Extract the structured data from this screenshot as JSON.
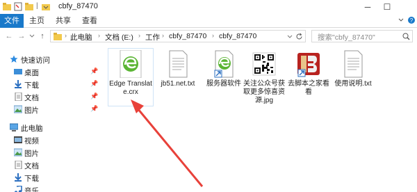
{
  "window": {
    "title": "cbfy_87470",
    "minimize_label": "─",
    "maximize_label": "☐"
  },
  "ribbon": {
    "tabs": [
      {
        "label": "文件",
        "active": true
      },
      {
        "label": "主页",
        "active": false
      },
      {
        "label": "共享",
        "active": false
      },
      {
        "label": "查看",
        "active": false
      }
    ],
    "expand_icon": "chevron-down-icon",
    "help_icon": "help-icon"
  },
  "address": {
    "back_label": "←",
    "forward_label": "→",
    "up_label": "↑",
    "crumbs": [
      "此电脑",
      "文档 (E:)",
      "工作",
      "cbfy_87470",
      "cbfy_87470"
    ],
    "separator": "›"
  },
  "search": {
    "placeholder": "搜索\"cbfy_87470\"",
    "icon": "search-icon"
  },
  "nav": {
    "quick_access": "快速访问",
    "quick_items": [
      "桌面",
      "下载",
      "文档",
      "图片"
    ],
    "this_pc": "此电脑",
    "pc_items": [
      "视频",
      "图片",
      "文档",
      "下载",
      "音乐"
    ]
  },
  "files": [
    {
      "name": "Edge Translate.crx",
      "icon": "edge-icon",
      "selected": true
    },
    {
      "name": "jb51.net.txt",
      "icon": "text-file-icon",
      "selected": false
    },
    {
      "name": "服务器软件",
      "icon": "edge-icon",
      "selected": false
    },
    {
      "name": "关注公众号获取更多惊喜资源.jpg",
      "icon": "qr-code-icon",
      "selected": false
    },
    {
      "name": "去脚本之家看看",
      "icon": "jb51-logo-icon",
      "selected": false
    },
    {
      "name": "使用说明.txt",
      "icon": "text-file-icon",
      "selected": false
    }
  ],
  "colors": {
    "accent": "#1979ca",
    "arrow": "#e8413a",
    "folder": "#f2c94c"
  }
}
